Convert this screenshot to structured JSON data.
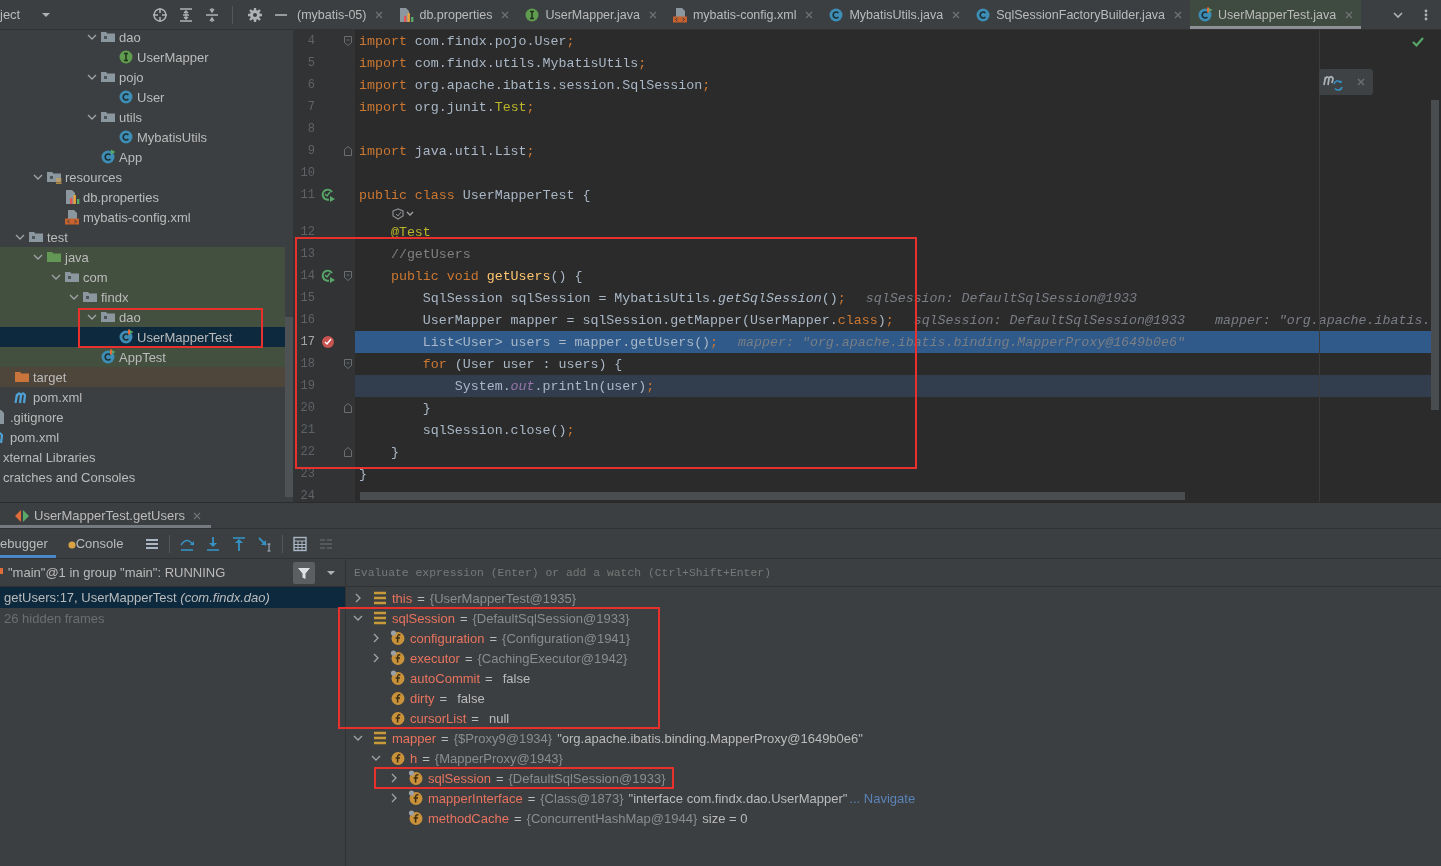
{
  "project_panel": {
    "title": "ject",
    "tree": [
      {
        "children": [
          {
            "children": [
              {
                "children": [
                  {
                    "children": [
                      {
                        "children": [
                          {
                            "children": [
                              {
                                "label": "dao",
                                "kind": "folder",
                                "expanded": true,
                                "selected": false,
                                "children": [
                                  {
                                    "label": "UserMapper",
                                    "kind": "interface",
                                    "selected": false
                                  }
                                ]
                              },
                              {
                                "label": "pojo",
                                "kind": "folder",
                                "expanded": true,
                                "selected": false,
                                "children": [
                                  {
                                    "label": "User",
                                    "kind": "class",
                                    "selected": false
                                  }
                                ]
                              },
                              {
                                "label": "utils",
                                "kind": "folder",
                                "expanded": true,
                                "selected": false,
                                "children": [
                                  {
                                    "label": "MybatisUtils",
                                    "kind": "class",
                                    "selected": false
                                  }
                                ]
                              },
                              {
                                "label": "App",
                                "kind": "class-run",
                                "selected": false
                              }
                            ]
                          }
                        ]
                      }
                    ]
                  },
                  {
                    "label": "resources",
                    "kind": "folder-resources",
                    "expanded": true,
                    "selected": false,
                    "children": [
                      {
                        "label": "db.properties",
                        "kind": "properties",
                        "selected": false
                      },
                      {
                        "label": "mybatis-config.xml",
                        "kind": "xml",
                        "selected": false
                      }
                    ]
                  }
                ]
              },
              {
                "label": "test",
                "kind": "folder",
                "expanded": true,
                "selected": false,
                "children": [
                  {
                    "label": "java",
                    "kind": "folder-source",
                    "expanded": true,
                    "selected": false,
                    "test_scope": true,
                    "children": [
                      {
                        "label": "com",
                        "kind": "folder",
                        "expanded": true,
                        "selected": false,
                        "test_scope": true,
                        "children": [
                          {
                            "label": "findx",
                            "kind": "folder",
                            "expanded": true,
                            "selected": false,
                            "test_scope": true,
                            "children": [
                              {
                                "label": "dao",
                                "kind": "folder",
                                "expanded": true,
                                "selected": false,
                                "test_scope": true,
                                "marked": true,
                                "children": [
                                  {
                                    "label": "UserMapperTest",
                                    "kind": "test-class",
                                    "selected": true
                                  }
                                ]
                              },
                              {
                                "label": "AppTest",
                                "kind": "test-class",
                                "selected": false,
                                "test_scope": true
                              }
                            ]
                          }
                        ]
                      }
                    ]
                  }
                ]
              }
            ]
          },
          {
            "label": "target",
            "kind": "folder-excluded",
            "selected": false,
            "excluded": true
          },
          {
            "label": "pom.xml",
            "kind": "maven",
            "selected": false
          }
        ]
      },
      {
        "label": ".gitignore",
        "kind": "ignored",
        "selected": false
      },
      {
        "label": "pom.xml",
        "kind": "maven",
        "selected": false
      },
      {
        "label": "xternal Libraries",
        "selected": false
      },
      {
        "label": "cratches and Consoles",
        "selected": false
      }
    ]
  },
  "editor": {
    "tabs": [
      {
        "label": "(mybatis-05)",
        "selected": false
      },
      {
        "label": "db.properties",
        "kind": "properties",
        "selected": false
      },
      {
        "label": "UserMapper.java",
        "kind": "interface",
        "selected": false
      },
      {
        "label": "mybatis-config.xml",
        "kind": "xml",
        "selected": false
      },
      {
        "label": "MybatisUtils.java",
        "kind": "class",
        "selected": false
      },
      {
        "label": "SqlSessionFactoryBuilder.java",
        "kind": "class",
        "selected": false
      },
      {
        "label": "UserMapperTest.java",
        "kind": "test-class",
        "selected": true
      }
    ],
    "lines": [
      {
        "kind": "code",
        "number": "4",
        "fold_start": true,
        "marked": false,
        "tokens": [
          {
            "kind": "keyword",
            "text": "import"
          },
          {
            "kind": "plain",
            "text": " com.findx.pojo.User"
          },
          {
            "kind": "keyword",
            "text": ";"
          }
        ]
      },
      {
        "kind": "code",
        "number": "5",
        "marked": false,
        "tokens": [
          {
            "kind": "keyword",
            "text": "import"
          },
          {
            "kind": "plain",
            "text": " com.findx.utils.MybatisUtils"
          },
          {
            "kind": "keyword",
            "text": ";"
          }
        ]
      },
      {
        "kind": "code",
        "number": "6",
        "marked": false,
        "tokens": [
          {
            "kind": "keyword",
            "text": "import"
          },
          {
            "kind": "plain",
            "text": " org.apache.ibatis.session.SqlSession"
          },
          {
            "kind": "keyword",
            "text": ";"
          }
        ]
      },
      {
        "kind": "code",
        "number": "7",
        "marked": false,
        "tokens": [
          {
            "kind": "keyword",
            "text": "import"
          },
          {
            "kind": "plain",
            "text": " org.junit."
          },
          {
            "kind": "annotation",
            "text": "Test"
          },
          {
            "kind": "keyword",
            "text": ";"
          }
        ]
      },
      {
        "kind": "code",
        "number": "8",
        "marked": false
      },
      {
        "kind": "code",
        "number": "9",
        "fold_end": true,
        "marked": false,
        "tokens": [
          {
            "kind": "keyword",
            "text": "import"
          },
          {
            "kind": "plain",
            "text": " java.util.List"
          },
          {
            "kind": "keyword",
            "text": ";"
          }
        ]
      },
      {
        "kind": "code",
        "number": "10",
        "marked": false
      },
      {
        "kind": "code",
        "number": "11",
        "run_marker": true,
        "marked": false,
        "tokens": [
          {
            "kind": "keyword",
            "text": "public class"
          },
          {
            "kind": "plain",
            "text": " UserMapperTest {"
          }
        ]
      },
      {
        "kind": "inlay",
        "marked": false
      },
      {
        "kind": "code",
        "number": "12",
        "marked": false,
        "tokens": [
          {
            "kind": "annotation",
            "text": "    @Test"
          }
        ]
      },
      {
        "kind": "code",
        "number": "13",
        "marked": true,
        "tokens": [
          {
            "kind": "comment",
            "text": "    //getUsers"
          }
        ]
      },
      {
        "kind": "code",
        "number": "14",
        "run_marker": true,
        "fold_start": true,
        "marked": true,
        "tokens": [
          {
            "kind": "keyword",
            "text": "    public void "
          },
          {
            "kind": "method",
            "text": "getUsers"
          },
          {
            "kind": "plain",
            "text": "() {"
          }
        ]
      },
      {
        "kind": "code",
        "number": "15",
        "marked": true,
        "tokens": [
          {
            "kind": "plain",
            "text": "        SqlSession sqlSession = MybatisUtils."
          },
          {
            "kind": "static",
            "text": "getSqlSession"
          },
          {
            "kind": "plain",
            "text": "()"
          },
          {
            "kind": "keyword",
            "text": ";"
          }
        ],
        "hints": [
          "sqlSession: DefaultSqlSession@1933"
        ]
      },
      {
        "kind": "code",
        "number": "16",
        "marked": true,
        "tokens": [
          {
            "kind": "plain",
            "text": "        UserMapper mapper = sqlSession.getMapper(UserMapper."
          },
          {
            "kind": "keyword",
            "text": "class"
          },
          {
            "kind": "plain",
            "text": ")"
          },
          {
            "kind": "keyword",
            "text": ";"
          }
        ],
        "hints": [
          "sqlSession: DefaultSqlSession@1933",
          "mapper: \"org.apache.ibatis."
        ]
      },
      {
        "kind": "code",
        "number": "17",
        "breakpoint": true,
        "execution_point": true,
        "marked": true,
        "tokens": [
          {
            "kind": "plain",
            "text": "        List<User> users = mapper.getUsers()"
          },
          {
            "kind": "keyword",
            "text": ";"
          }
        ],
        "hints": [
          "mapper: \"org.apache.ibatis.binding.MapperProxy@1649b0e6\""
        ]
      },
      {
        "kind": "code",
        "number": "18",
        "fold_start": true,
        "marked": true,
        "tokens": [
          {
            "kind": "keyword",
            "text": "        for"
          },
          {
            "kind": "plain",
            "text": " (User user : users) {"
          }
        ]
      },
      {
        "kind": "code",
        "number": "19",
        "caret_line": true,
        "marked": true,
        "tokens": [
          {
            "kind": "plain",
            "text": "            System."
          },
          {
            "kind": "field",
            "text": "out"
          },
          {
            "kind": "plain",
            "text": ".println(user)"
          },
          {
            "kind": "keyword",
            "text": ";"
          }
        ]
      },
      {
        "kind": "code",
        "number": "20",
        "fold_end": true,
        "marked": true,
        "tokens": [
          {
            "kind": "plain",
            "text": "        }"
          }
        ]
      },
      {
        "kind": "code",
        "number": "21",
        "marked": true,
        "tokens": [
          {
            "kind": "plain",
            "text": "        sqlSession.close()"
          },
          {
            "kind": "keyword",
            "text": ";"
          }
        ]
      },
      {
        "kind": "code",
        "number": "22",
        "fold_end": true,
        "marked": true,
        "tokens": [
          {
            "kind": "plain",
            "text": "    }"
          }
        ]
      },
      {
        "kind": "code",
        "number": "23",
        "marked": false,
        "tokens": [
          {
            "kind": "plain",
            "text": "}"
          }
        ]
      },
      {
        "kind": "code",
        "number": "24",
        "marked": false
      }
    ]
  },
  "debug": {
    "session_tab": {
      "label": "UserMapperTest.getUsers"
    },
    "tabs": [
      {
        "label": "ebugger",
        "selected": true
      },
      {
        "label": "Console",
        "kind": "console",
        "selected": false
      }
    ],
    "thread": "\"main\"@1 in group \"main\": RUNNING",
    "frames": [
      {
        "text": "getUsers:17, UserMapperTest *(com.findx.dao)*",
        "kind": "frame",
        "selected": true
      },
      {
        "text": "26 hidden frames",
        "kind": "hidden",
        "selected": false
      }
    ],
    "evaluate": {
      "placeholder": "Evaluate expression (Enter) or add a watch (Ctrl+Shift+Enter)"
    },
    "variables": [
      {
        "name": "this",
        "eq": "=",
        "ref": "{UserMapperTest@1935}",
        "kind": "object",
        "expanded": false
      },
      {
        "name": "sqlSession",
        "eq": "=",
        "ref": "{DefaultSqlSession@1933}",
        "kind": "object",
        "expanded": true,
        "marked": true,
        "children": [
          {
            "name": "configuration",
            "eq": "=",
            "ref": "{Configuration@1941}",
            "kind": "field",
            "final": true,
            "expanded": false
          },
          {
            "name": "executor",
            "eq": "=",
            "ref": "{CachingExecutor@1942}",
            "kind": "field",
            "final": true,
            "expanded": false
          },
          {
            "name": "autoCommit",
            "eq": "=",
            "value": "false",
            "kind": "field",
            "final": true
          },
          {
            "name": "dirty",
            "eq": "=",
            "value": "false",
            "kind": "field",
            "final": false
          },
          {
            "name": "cursorList",
            "eq": "=",
            "value": "null",
            "kind": "field",
            "final": false
          }
        ]
      },
      {
        "name": "mapper",
        "eq": "=",
        "ref": "{$Proxy9@1934}",
        "value": "\"org.apache.ibatis.binding.MapperProxy@1649b0e6\"",
        "kind": "object",
        "expanded": true,
        "children": [
          {
            "name": "h",
            "eq": "=",
            "ref": "{MapperProxy@1943}",
            "kind": "field",
            "final": false,
            "expanded": true,
            "children": [
              {
                "name": "sqlSession",
                "eq": "=",
                "ref": "{DefaultSqlSession@1933}",
                "kind": "field",
                "final": true,
                "expanded": false,
                "marked": true
              },
              {
                "name": "mapperInterface",
                "eq": "=",
                "ref": "{Class@1873}",
                "value": "\"interface com.findx.dao.UserMapper\"",
                "link": "... Navigate",
                "kind": "field",
                "final": true,
                "expanded": false
              },
              {
                "name": "methodCache",
                "eq": "=",
                "ref": "{ConcurrentHashMap@1944}",
                "value": "size = 0",
                "kind": "field",
                "final": true
              }
            ]
          }
        ]
      }
    ]
  }
}
